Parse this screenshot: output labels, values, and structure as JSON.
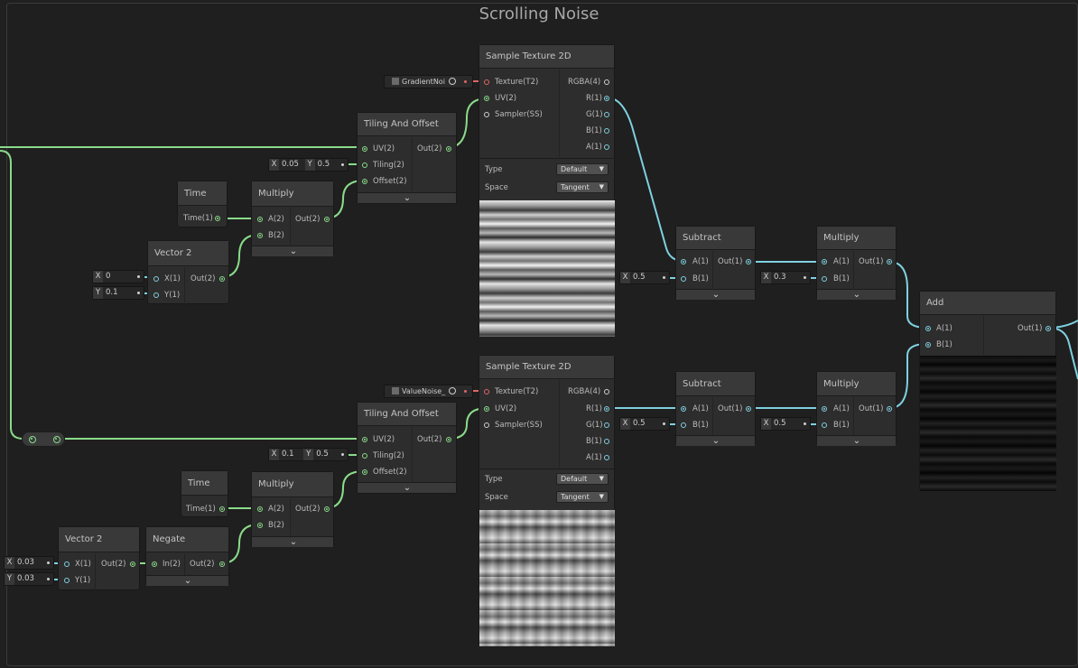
{
  "group": {
    "title": "Scrolling Noise"
  },
  "nodes": {
    "sample_top": {
      "title": "Sample Texture 2D",
      "in": [
        "Texture(T2)",
        "UV(2)",
        "Sampler(SS)"
      ],
      "out": [
        "RGBA(4)",
        "R(1)",
        "G(1)",
        "B(1)",
        "A(1)"
      ],
      "type_label": "Type",
      "type_value": "Default",
      "space_label": "Space",
      "space_value": "Tangent",
      "texture_name": "GradientNoi"
    },
    "sample_bottom": {
      "title": "Sample Texture 2D",
      "in": [
        "Texture(T2)",
        "UV(2)",
        "Sampler(SS)"
      ],
      "out": [
        "RGBA(4)",
        "R(1)",
        "G(1)",
        "B(1)",
        "A(1)"
      ],
      "type_label": "Type",
      "type_value": "Default",
      "space_label": "Space",
      "space_value": "Tangent",
      "texture_name": "ValueNoise_"
    },
    "tiling_top": {
      "title": "Tiling And Offset",
      "in": [
        "UV(2)",
        "Tiling(2)",
        "Offset(2)"
      ],
      "out": "Out(2)",
      "tiling": {
        "x_label": "X",
        "x": "0.05",
        "y_label": "Y",
        "y": "0.5"
      }
    },
    "tiling_bottom": {
      "title": "Tiling And Offset",
      "in": [
        "UV(2)",
        "Tiling(2)",
        "Offset(2)"
      ],
      "out": "Out(2)",
      "tiling": {
        "x_label": "X",
        "x": "0.1",
        "y_label": "Y",
        "y": "0.5"
      }
    },
    "time_top": {
      "title": "Time",
      "out": "Time(1)"
    },
    "time_bottom": {
      "title": "Time",
      "out": "Time(1)"
    },
    "multiply_top": {
      "title": "Multiply",
      "in": [
        "A(2)",
        "B(2)"
      ],
      "out": "Out(2)"
    },
    "multiply_bottom": {
      "title": "Multiply",
      "in": [
        "A(2)",
        "B(2)"
      ],
      "out": "Out(2)"
    },
    "vector2_top": {
      "title": "Vector 2",
      "in": [
        "X(1)",
        "Y(1)"
      ],
      "out": "Out(2)",
      "x_label": "X",
      "x": "0",
      "y_label": "Y",
      "y": "0.1"
    },
    "vector2_bottom": {
      "title": "Vector 2",
      "in": [
        "X(1)",
        "Y(1)"
      ],
      "out": "Out(2)",
      "x_label": "X",
      "x": "0.03",
      "y_label": "Y",
      "y": "0.03"
    },
    "negate": {
      "title": "Negate",
      "in": "In(2)",
      "out": "Out(2)"
    },
    "subtract_top": {
      "title": "Subtract",
      "in": [
        "A(1)",
        "B(1)"
      ],
      "out": "Out(1)",
      "b_label": "X",
      "b": "0.5"
    },
    "subtract_bottom": {
      "title": "Subtract",
      "in": [
        "A(1)",
        "B(1)"
      ],
      "out": "Out(1)",
      "b_label": "X",
      "b": "0.5"
    },
    "mult_r_top": {
      "title": "Multiply",
      "in": [
        "A(1)",
        "B(1)"
      ],
      "out": "Out(1)",
      "b_label": "X",
      "b": "0.3"
    },
    "mult_r_bottom": {
      "title": "Multiply",
      "in": [
        "A(1)",
        "B(1)"
      ],
      "out": "Out(1)",
      "b_label": "X",
      "b": "0.5"
    },
    "add": {
      "title": "Add",
      "in": [
        "A(1)",
        "B(1)"
      ],
      "out": "Out(1)"
    }
  },
  "colors": {
    "vector_wire": "#8adb8a",
    "float_wire": "#7fd0e0",
    "texture_port": "#e06565",
    "background": "#202020",
    "node": "#2d2d2d"
  }
}
